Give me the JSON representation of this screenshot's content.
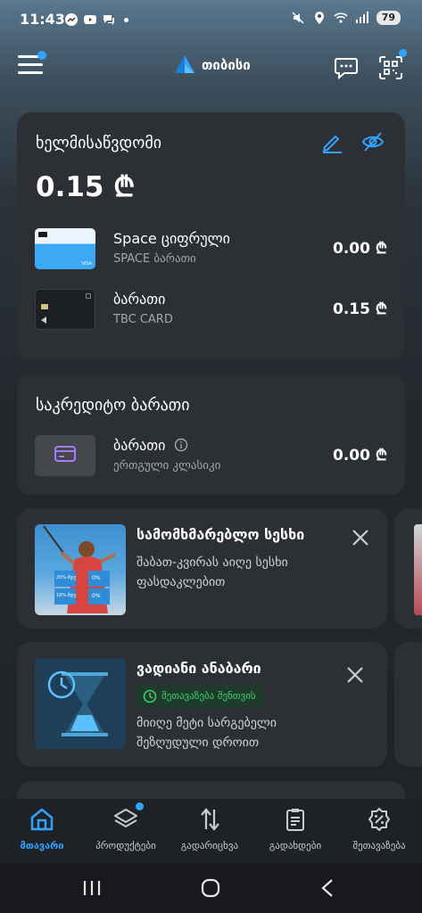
{
  "status_bar": {
    "time": "11:43",
    "battery": "79"
  },
  "header": {
    "logo_text": "თიბისი"
  },
  "balance_card": {
    "title": "ხელმისაწვდომი",
    "total": "0.15 ₾",
    "accounts": [
      {
        "name": "Space ციფრული",
        "sub": "SPACE ბარათი",
        "amount": "0.00 ₾"
      },
      {
        "name": "ბარათი",
        "sub": "TBC CARD",
        "amount": "0.15 ₾"
      }
    ]
  },
  "credit_card": {
    "title": "საკრედიტო ბარათი",
    "account": {
      "name": "ბარათი",
      "sub": "ერთგული კლასიკი",
      "amount": "0.00 ₾"
    }
  },
  "promos": [
    {
      "title": "სამომხმარებლო სესხი",
      "desc_line1": "შაბათ-კვირას აიღე სესხი",
      "desc_line2": "ფასდაკლებით",
      "img_labels": [
        "20%-მდე",
        "0%",
        "18%-მდე",
        "0%"
      ]
    },
    {
      "title": "ვადიანი ანაბარი",
      "badge": "შეთავაზება შენთვის",
      "desc_line1": "მიიღე მეტი სარგებელი",
      "desc_line2": "შეზღუდული დროით"
    }
  ],
  "bottom_nav": [
    {
      "label": "მთავარი",
      "icon": "home-icon"
    },
    {
      "label": "პროდუქტები",
      "icon": "layers-icon"
    },
    {
      "label": "გადარიცხვა",
      "icon": "transfer-icon"
    },
    {
      "label": "გადახდები",
      "icon": "clipboard-icon"
    },
    {
      "label": "შეთავაზება",
      "icon": "discount-badge-icon"
    }
  ],
  "colors": {
    "accent": "#2ea3ff",
    "card_bg": "#2c3034",
    "success": "#3ccf6e"
  }
}
